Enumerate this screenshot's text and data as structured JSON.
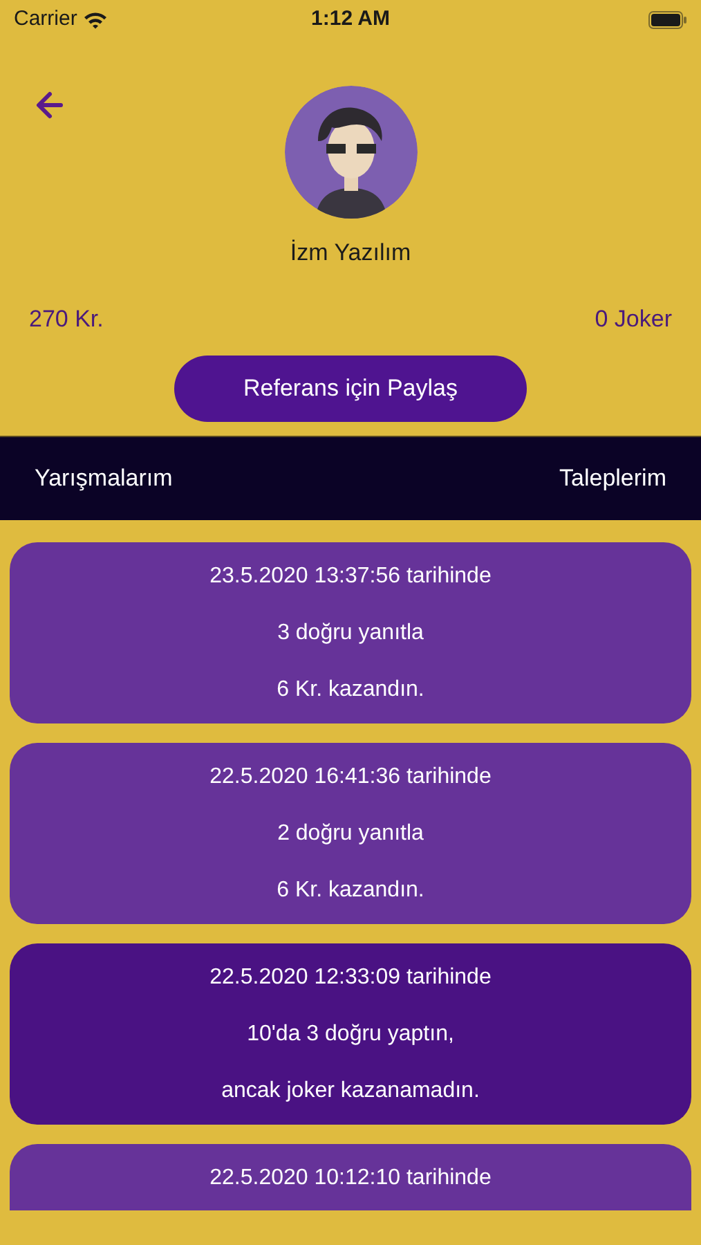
{
  "status_bar": {
    "carrier": "Carrier",
    "time": "1:12 AM"
  },
  "profile": {
    "name": "İzm Yazılım",
    "credits": "270 Kr.",
    "jokers": "0 Joker"
  },
  "share_button": "Referans için Paylaş",
  "tabs": [
    {
      "label": "Yarışmalarım"
    },
    {
      "label": "Taleplerim"
    }
  ],
  "history": [
    {
      "kind": "won",
      "lines": [
        "23.5.2020 13:37:56 tarihinde",
        "3 doğru yanıtla",
        "6 Kr. kazandın."
      ]
    },
    {
      "kind": "won",
      "lines": [
        "22.5.2020 16:41:36 tarihinde",
        "2 doğru yanıtla",
        "6 Kr. kazandın."
      ]
    },
    {
      "kind": "missed",
      "lines": [
        "22.5.2020 12:33:09 tarihinde",
        "10'da 3 doğru yaptın,",
        "ancak joker kazanamadın."
      ]
    },
    {
      "kind": "won",
      "lines": [
        "22.5.2020 10:12:10 tarihinde"
      ]
    }
  ]
}
